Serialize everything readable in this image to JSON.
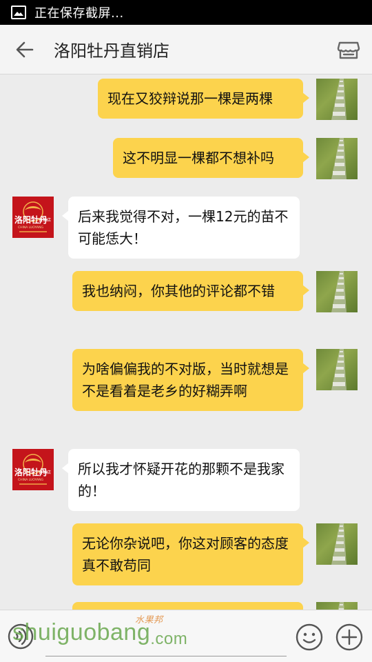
{
  "status_bar": {
    "text": "正在保存截屏...",
    "icon": "image-icon"
  },
  "header": {
    "title": "洛阳牡丹直销店",
    "back_icon": "arrow-left-icon",
    "store_icon": "store-icon"
  },
  "messages": [
    {
      "side": "right",
      "text": "现在又狡辩说那一棵是两棵"
    },
    {
      "side": "right",
      "text": "这不明显一棵都不想补吗"
    },
    {
      "side": "left",
      "text": "后来我觉得不对，一棵12元的苗不可能恁大！"
    },
    {
      "side": "right",
      "text": "我也纳闷，你其他的评论都不错"
    },
    {
      "side": "right",
      "text": "为啥偏偏我的不对版，当时就想是不是看着是老乡的好糊弄啊"
    },
    {
      "side": "left",
      "text": "所以我才怀疑开花的那颗不是我家的！"
    },
    {
      "side": "right",
      "text": "无论你杂说吧，你这对顾客的态度真不敢苟同"
    },
    {
      "side": "right",
      "text": ""
    }
  ],
  "shop_avatar": {
    "name": "洛阳牡丹",
    "sub": "直销店",
    "en": "CHINA LUOYANG"
  },
  "input_bar": {
    "voice_icon": "voice-icon",
    "emoji_icon": "emoji-icon",
    "plus_icon": "plus-icon"
  },
  "watermark": {
    "latin": "shuiguobang",
    "com": ".com",
    "cn": "水果邦"
  },
  "colors": {
    "bubble_right": "#fcd34d",
    "bubble_left": "#ffffff",
    "background": "#ececec"
  }
}
